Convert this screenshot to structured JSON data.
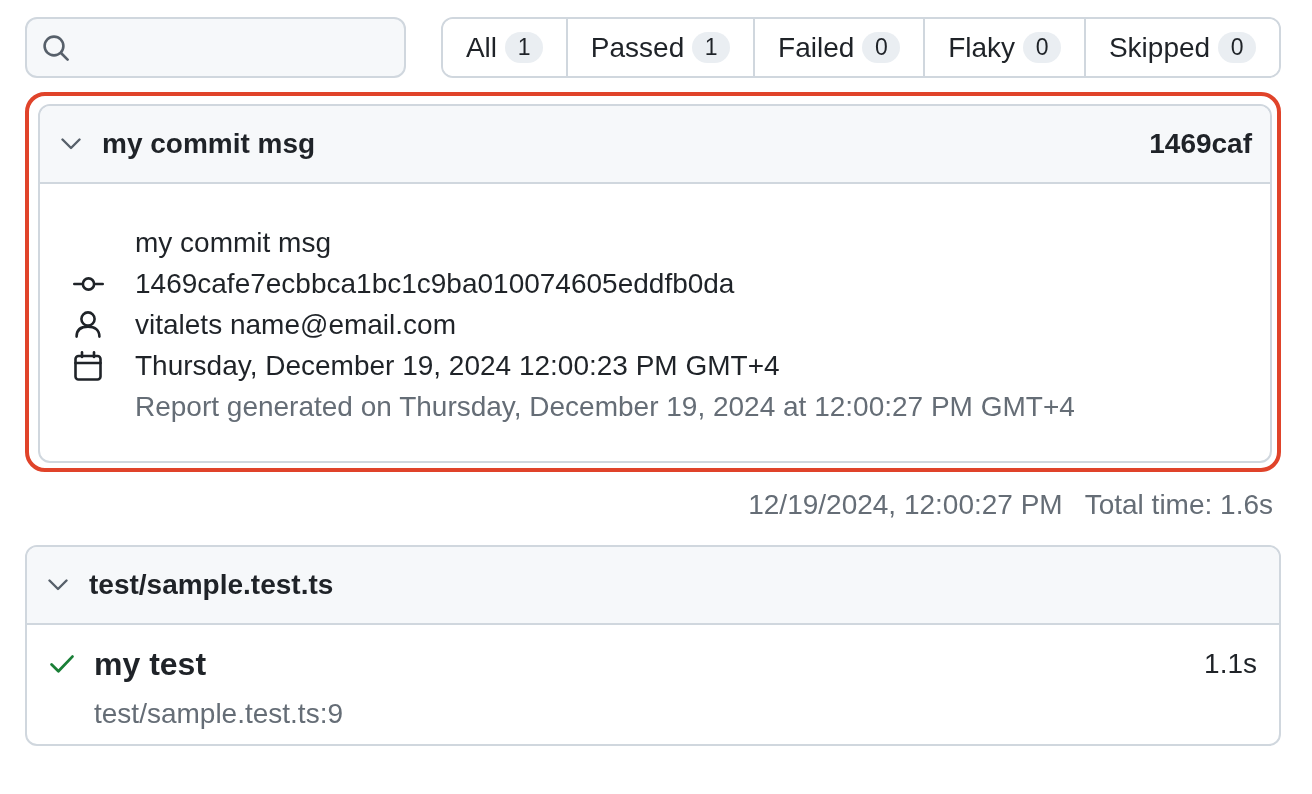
{
  "filters": [
    {
      "label": "All",
      "count": "1",
      "selected": false
    },
    {
      "label": "Passed",
      "count": "1",
      "selected": false
    },
    {
      "label": "Failed",
      "count": "0",
      "selected": false
    },
    {
      "label": "Flaky",
      "count": "0",
      "selected": false
    },
    {
      "label": "Skipped",
      "count": "0",
      "selected": false
    }
  ],
  "commit": {
    "highlighted": true,
    "expanded": true,
    "title": "my commit msg",
    "short_hash": "1469caf",
    "message": "my commit msg",
    "details": [
      {
        "kind": "hash",
        "text": "1469cafe7ecbbca1bc1c9ba010074605eddfb0da"
      },
      {
        "kind": "author",
        "text": "vitalets name@email.com"
      },
      {
        "kind": "date",
        "text": "Thursday, December 19, 2024 12:00:23 PM GMT+4"
      }
    ],
    "report_note": "Report generated on Thursday, December 19, 2024 at 12:00:27 PM GMT+4"
  },
  "summary": {
    "date": "12/19/2024, 12:00:27 PM",
    "total_time": "Total time: 1.6s"
  },
  "files": [
    {
      "name": "test/sample.test.ts",
      "expanded": true,
      "tests": [
        {
          "kind": "passed",
          "title": "my test",
          "duration": "1.1s",
          "location": "test/sample.test.ts:9"
        }
      ]
    }
  ]
}
